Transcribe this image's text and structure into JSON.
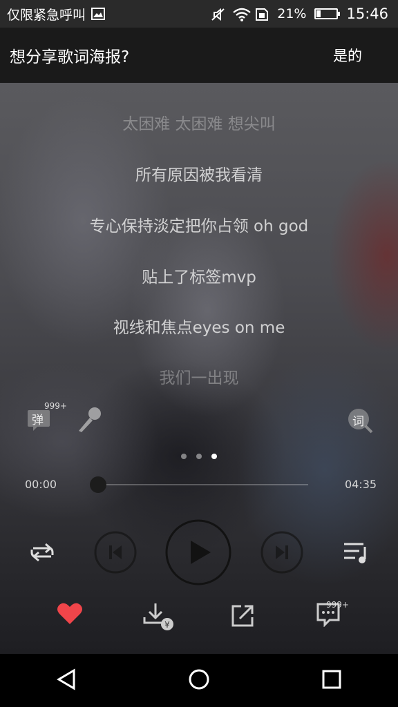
{
  "status_bar": {
    "carrier": "仅限紧急呼叫",
    "battery": "21%",
    "battery_level": 0.21,
    "time": "15:46"
  },
  "prompt": {
    "question": "想分享歌词海报?",
    "confirm": "是的"
  },
  "lyrics": [
    {
      "text": "太困难 太困难 想尖叫",
      "dim": true
    },
    {
      "text": "所有原因被我看清",
      "dim": false
    },
    {
      "text": "专心保持淡定把你占领 oh god",
      "dim": false
    },
    {
      "text": "贴上了标签mvp",
      "dim": false
    },
    {
      "text": "视线和焦点eyes on me",
      "dim": false
    },
    {
      "text": "我们一出现",
      "dim": true
    }
  ],
  "danmu": {
    "label": "弹",
    "count": "999+"
  },
  "lyric_search_label": "词",
  "pager": {
    "count": 3,
    "active": 2
  },
  "playback": {
    "current_time": "00:00",
    "total_time": "04:35",
    "progress": 0.0
  },
  "comments_count": "999+",
  "icons": {
    "status": [
      "image-icon",
      "mute-icon",
      "wifi-icon",
      "sim-icon",
      "battery-icon"
    ],
    "player": [
      "danmu-icon",
      "microphone-icon",
      "lyric-search-icon",
      "repeat-icon",
      "previous-icon",
      "play-icon",
      "next-icon",
      "playlist-icon",
      "like-icon",
      "download-icon",
      "share-icon",
      "comment-icon"
    ],
    "nav": [
      "back-icon",
      "home-icon",
      "recents-icon"
    ]
  },
  "colors": {
    "like": "#f0454a"
  }
}
